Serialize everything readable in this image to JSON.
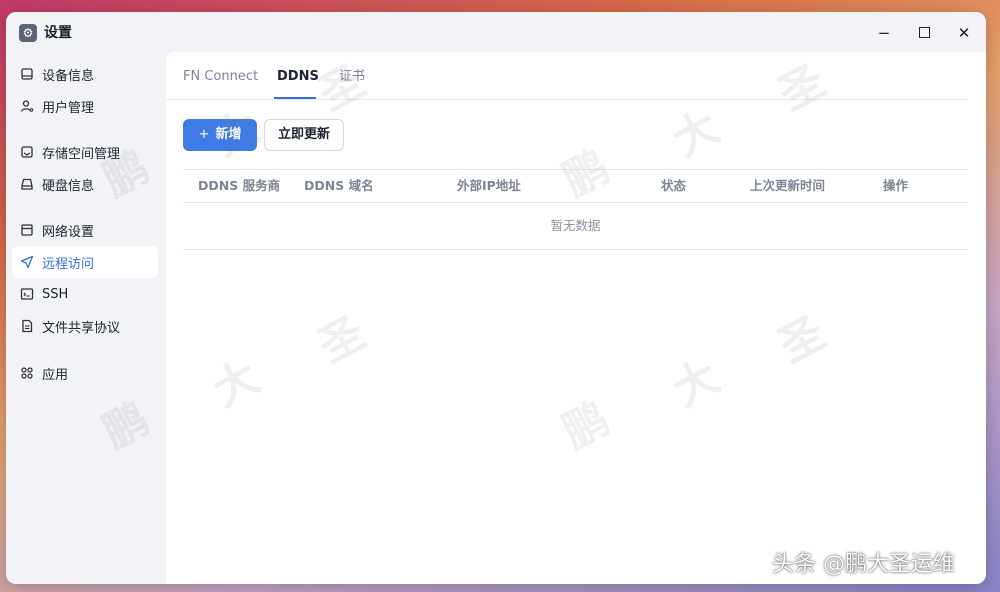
{
  "window": {
    "title": "设置",
    "icon": "gear-icon"
  },
  "sidebar": {
    "items": [
      {
        "label": "设备信息",
        "icon": "device-icon"
      },
      {
        "label": "用户管理",
        "icon": "user-icon"
      },
      {
        "label": "存储空间管理",
        "icon": "storage-icon"
      },
      {
        "label": "硬盘信息",
        "icon": "disk-icon"
      },
      {
        "label": "网络设置",
        "icon": "network-icon"
      },
      {
        "label": "远程访问",
        "icon": "send-icon",
        "active": true
      },
      {
        "label": "SSH",
        "icon": "terminal-icon"
      },
      {
        "label": "文件共享协议",
        "icon": "document-icon"
      },
      {
        "label": "应用",
        "icon": "apps-icon"
      }
    ]
  },
  "tabs": [
    {
      "label": "FN Connect"
    },
    {
      "label": "DDNS",
      "active": true
    },
    {
      "label": "证书"
    }
  ],
  "toolbar": {
    "add_icon": "+",
    "add_label": "新增",
    "update_label": "立即更新"
  },
  "table": {
    "columns": [
      "DDNS 服务商",
      "DDNS 域名",
      "外部IP地址",
      "状态",
      "上次更新时间",
      "操作"
    ],
    "empty_text": "暂无数据"
  },
  "watermark": {
    "chars": [
      "鹏",
      "大",
      "圣"
    ]
  },
  "credit": "头条 @鹏大圣运维",
  "colors": {
    "accent": "#2f6fe0",
    "primary_button": "#3f7ae6",
    "sidebar_bg": "#f1f3f7"
  }
}
